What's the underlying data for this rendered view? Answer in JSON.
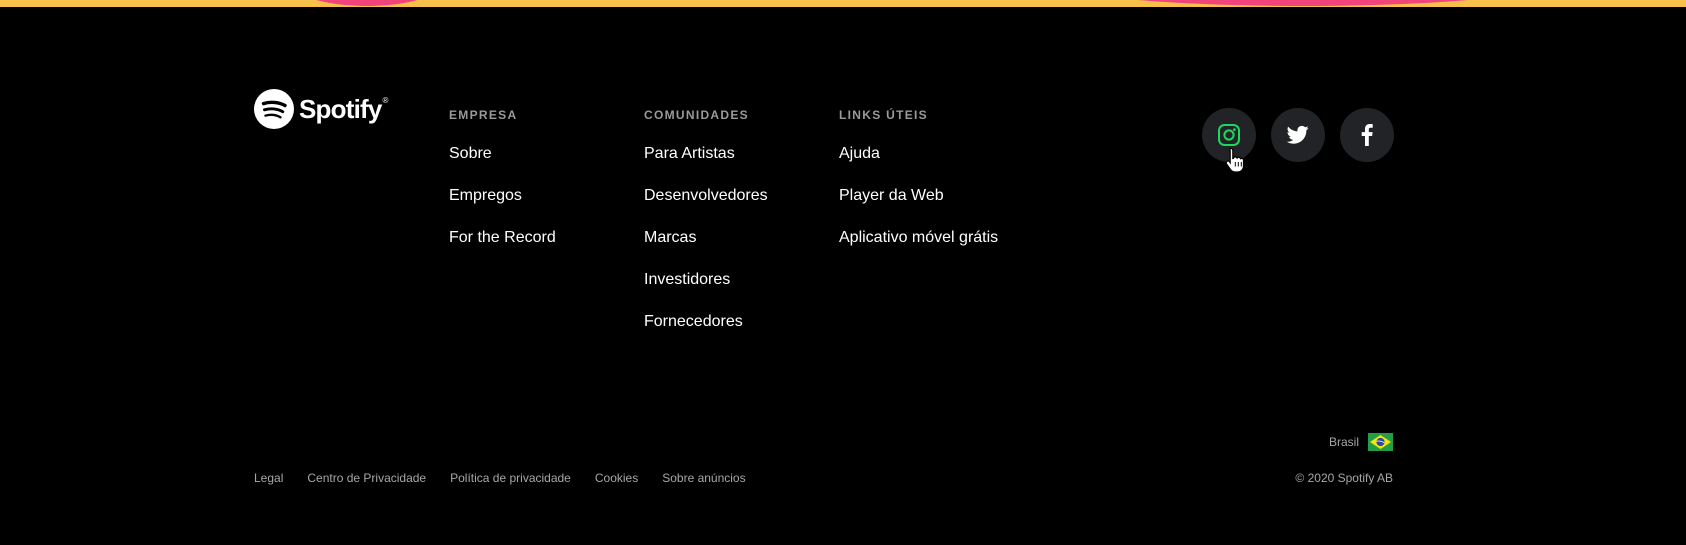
{
  "brand": {
    "name": "Spotify",
    "logo_icon": "spotify-logo-icon",
    "reg_mark": "®"
  },
  "colors": {
    "background": "#000000",
    "top_band": "#f7c04a",
    "top_band_accent": "#f0447a",
    "heading": "#9a9a9a",
    "muted_text": "#a7a7a7",
    "social_bg": "#222326",
    "instagram_hover": "#1ed760"
  },
  "columns": [
    {
      "title": "EMPRESA",
      "links": [
        "Sobre",
        "Empregos",
        "For the Record"
      ]
    },
    {
      "title": "COMUNIDADES",
      "links": [
        "Para Artistas",
        "Desenvolvedores",
        "Marcas",
        "Investidores",
        "Fornecedores"
      ]
    },
    {
      "title": "LINKS ÚTEIS",
      "links": [
        "Ajuda",
        "Player da Web",
        "Aplicativo móvel grátis"
      ]
    }
  ],
  "social": [
    {
      "icon": "instagram-icon",
      "state": "hover"
    },
    {
      "icon": "twitter-icon"
    },
    {
      "icon": "facebook-icon"
    }
  ],
  "legal_links": [
    "Legal",
    "Centro de Privacidade",
    "Política de privacidade",
    "Cookies",
    "Sobre anúncios"
  ],
  "country": {
    "label": "Brasil",
    "flag_icon": "brazil-flag-icon"
  },
  "copyright": "© 2020 Spotify AB"
}
